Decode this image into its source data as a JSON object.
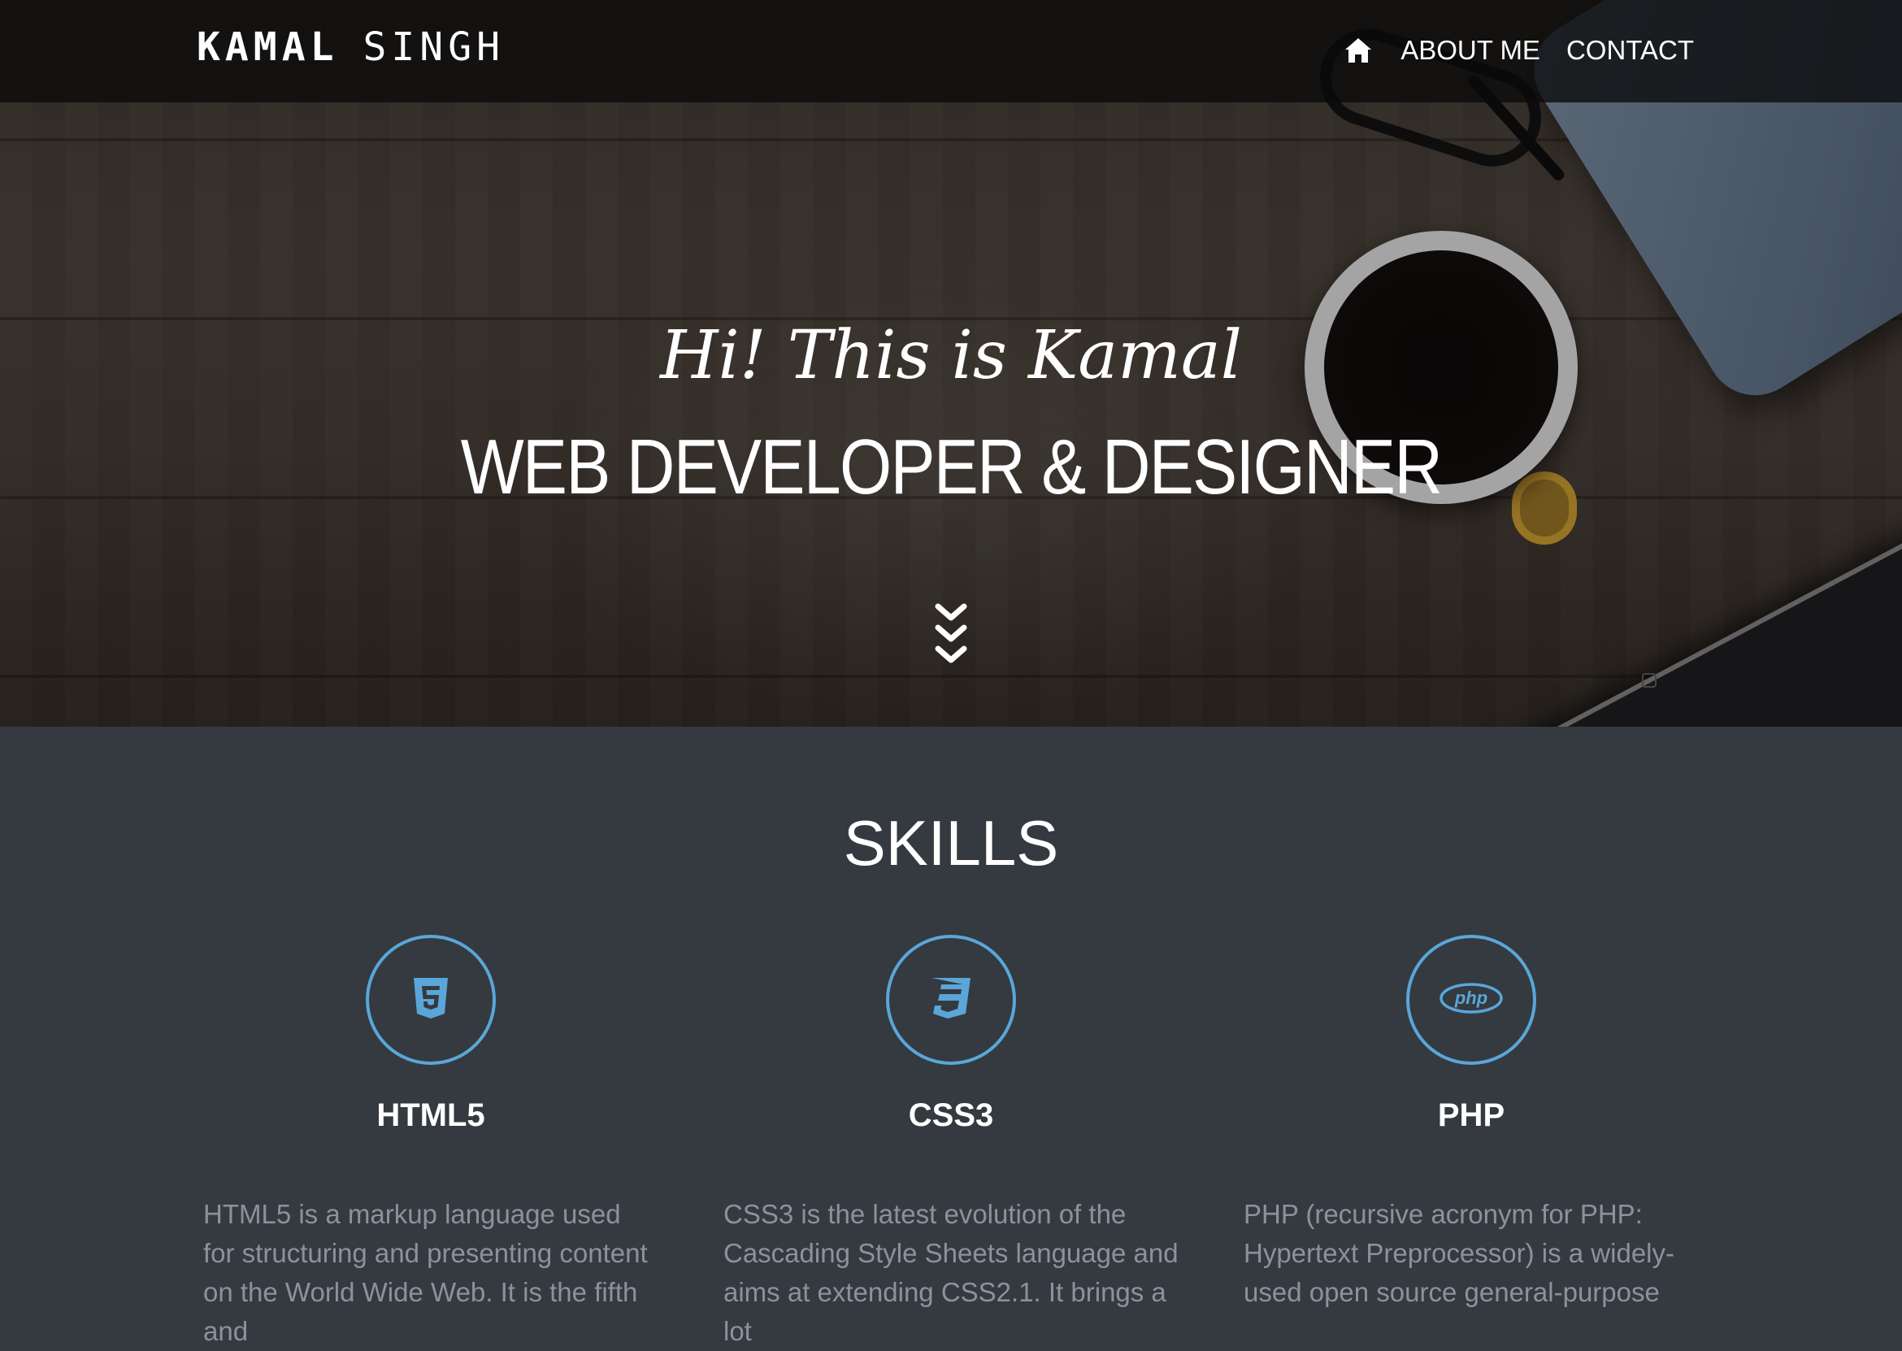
{
  "navbar": {
    "brand_first": "KAMAL",
    "brand_last": "SINGH",
    "items": [
      {
        "label": "ABOUT ME"
      },
      {
        "label": "CONTACT"
      }
    ],
    "home_icon": "home-icon"
  },
  "hero": {
    "greeting": "Hi! This is Kamal",
    "role": "WEB DEVELOPER & DESIGNER",
    "scroll_icon": "chevrons-down-icon"
  },
  "skills": {
    "title": "SKILLS",
    "items": [
      {
        "name": "HTML5",
        "icon": "html5-icon",
        "description": "HTML5 is a markup language used for structuring and presenting content on the World Wide Web. It is the fifth and"
      },
      {
        "name": "CSS3",
        "icon": "css3-icon",
        "description": "CSS3 is the latest evolution of the Cascading Style Sheets language and aims at extending CSS2.1. It brings a lot"
      },
      {
        "name": "PHP",
        "icon": "php-icon",
        "description": "PHP (recursive acronym for PHP: Hypertext Preprocessor) is a widely-used open source general-purpose"
      }
    ]
  },
  "colors": {
    "accent": "#5aa6d8",
    "section_bg": "#343a40",
    "navbar_bg": "#0a0a0a",
    "muted_text": "#8a939c"
  }
}
